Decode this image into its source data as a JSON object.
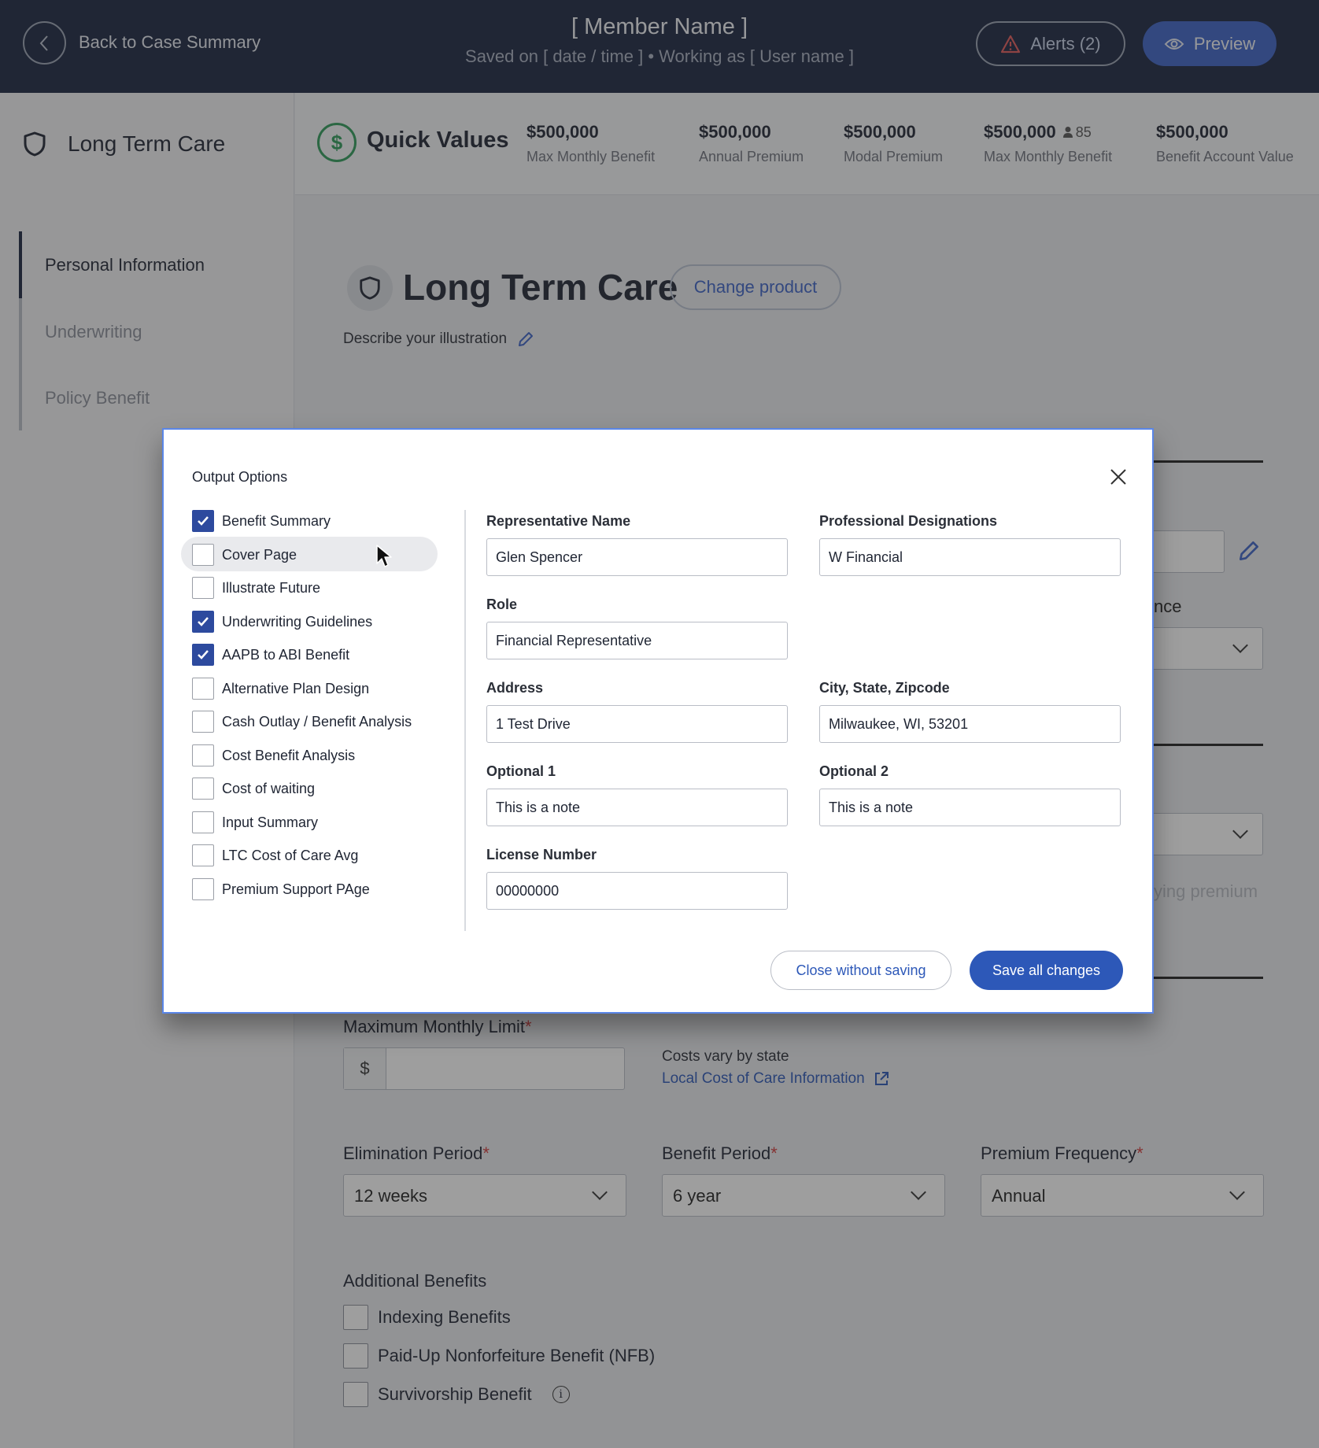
{
  "header": {
    "back_label": "Back to Case Summary",
    "member_name": "[ Member Name ]",
    "saved_line": "Saved on [ date / time ] • Working as [ User name ]",
    "alerts_label": "Alerts (2)",
    "preview_label": "Preview"
  },
  "sidebar": {
    "product": "Long Term Care",
    "items": [
      {
        "label": "Personal Information",
        "active": true
      },
      {
        "label": "Underwriting",
        "active": false
      },
      {
        "label": "Policy Benefit",
        "active": false
      }
    ]
  },
  "quick_values": {
    "icon_glyph": "$",
    "title": "Quick Values",
    "items": [
      {
        "value": "$500,000",
        "label": "Max Monthly Benefit"
      },
      {
        "value": "$500,000",
        "label": "Annual Premium"
      },
      {
        "value": "$500,000",
        "label": "Modal Premium"
      },
      {
        "value": "$500,000",
        "age": "85",
        "label": "Max Monthly Benefit"
      },
      {
        "value": "$500,000",
        "label": "Benefit Account Value"
      }
    ]
  },
  "main": {
    "title": "Long Term Care",
    "change_product": "Change product",
    "describe": "Describe your illustration",
    "partial_label_nce": "nce",
    "partial_ying_premium": "ying premium",
    "max_monthly_limit": "Maximum Monthly Limit",
    "dollar": "$",
    "costs_vary": "Costs vary by state",
    "local_cost_link": "Local Cost of Care Information",
    "elimination_label": "Elimination Period",
    "elimination_value": "12 weeks",
    "benefit_period_label": "Benefit Period",
    "benefit_period_value": "6 year",
    "premium_freq_label": "Premium Frequency",
    "premium_freq_value": "Annual",
    "required_mark": "*",
    "additional_title": "Additional Benefits",
    "additional": [
      {
        "label": "Indexing Benefits",
        "checked": false
      },
      {
        "label": "Paid-Up Nonforfeiture Benefit (NFB)",
        "checked": false
      },
      {
        "label": "Survivorship Benefit",
        "checked": false
      }
    ],
    "info_glyph": "i"
  },
  "modal": {
    "title": "Output Options",
    "check_glyph": "✓",
    "options": [
      {
        "label": "Benefit Summary",
        "checked": true
      },
      {
        "label": "Cover Page",
        "checked": false,
        "hover": true
      },
      {
        "label": "Illustrate Future",
        "checked": false
      },
      {
        "label": "Underwriting Guidelines",
        "checked": true
      },
      {
        "label": "AAPB to ABI Benefit",
        "checked": true
      },
      {
        "label": "Alternative Plan Design",
        "checked": false
      },
      {
        "label": "Cash Outlay / Benefit Analysis",
        "checked": false
      },
      {
        "label": "Cost Benefit Analysis",
        "checked": false
      },
      {
        "label": "Cost of waiting",
        "checked": false
      },
      {
        "label": "Input Summary",
        "checked": false
      },
      {
        "label": "LTC Cost of Care Avg",
        "checked": false
      },
      {
        "label": "Premium Support PAge",
        "checked": false
      }
    ],
    "fields": {
      "rep_name": {
        "label": "Representative Name",
        "value": "Glen Spencer"
      },
      "prof_designations": {
        "label": "Professional Designations",
        "value": "W Financial"
      },
      "role": {
        "label": "Role",
        "value": "Financial Representative"
      },
      "address": {
        "label": "Address",
        "value": "1 Test Drive"
      },
      "city_state_zip": {
        "label": "City, State, Zipcode",
        "value": "Milwaukee, WI, 53201"
      },
      "optional1": {
        "label": "Optional 1",
        "value": "This is a note"
      },
      "optional2": {
        "label": "Optional 2",
        "value": "This is a note"
      },
      "license": {
        "label": "License Number",
        "value": "00000000"
      }
    },
    "close_without_saving": "Close without saving",
    "save_all": "Save all changes"
  },
  "colors": {
    "header_bg": "#1a2540",
    "accent_blue": "#2d58b8",
    "checkbox_checked": "#2d4a9e",
    "quick_values_green": "#2e9c5a",
    "required_red": "#d23b3b"
  },
  "icons": [
    "chevron-left-icon",
    "warning-triangle-icon",
    "eye-icon",
    "shield-icon",
    "dollar-circle-icon",
    "person-icon",
    "pencil-icon",
    "chevron-down-icon",
    "external-link-icon",
    "info-icon",
    "close-icon",
    "checkmark-icon",
    "mouse-cursor-icon"
  ]
}
